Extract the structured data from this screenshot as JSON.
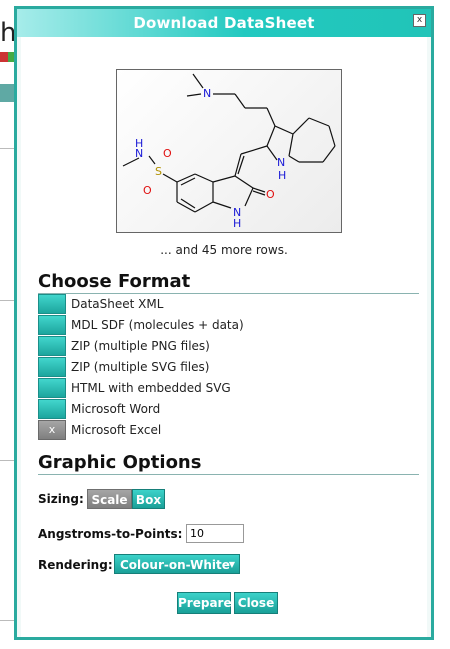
{
  "dialog": {
    "title": "Download DataSheet",
    "close_glyph": "x"
  },
  "preview": {
    "more_rows_text": "... and 45 more rows.",
    "atom_labels": [
      "N",
      "N",
      "H",
      "O",
      "S",
      "O",
      "N",
      "H",
      "O",
      "N",
      "H"
    ]
  },
  "choose_format": {
    "heading": "Choose Format",
    "items": [
      {
        "label": "DataSheet XML",
        "mark": ""
      },
      {
        "label": "MDL SDF (molecules + data)",
        "mark": ""
      },
      {
        "label": "ZIP (multiple PNG files)",
        "mark": ""
      },
      {
        "label": "ZIP (multiple SVG files)",
        "mark": ""
      },
      {
        "label": "HTML with embedded SVG",
        "mark": ""
      },
      {
        "label": "Microsoft Word",
        "mark": ""
      },
      {
        "label": "Microsoft Excel",
        "mark": "x"
      }
    ]
  },
  "graphic_options": {
    "heading": "Graphic Options",
    "sizing_label": "Sizing:",
    "sizing_options": [
      "Scale",
      "Box"
    ],
    "angstroms_label": "Angstroms-to-Points:",
    "angstroms_value": "10",
    "rendering_label": "Rendering:",
    "rendering_value": "Colour-on-White"
  },
  "actions": {
    "prepare_label": "Prepare",
    "close_label": "Close"
  },
  "colors": {
    "accent": "#22c9c0",
    "accent_dark": "#1aa39b",
    "inactive": "#8d8d8d",
    "hetero_N": "#1a1ad6",
    "hetero_O": "#e01010",
    "hetero_S": "#b09000"
  }
}
